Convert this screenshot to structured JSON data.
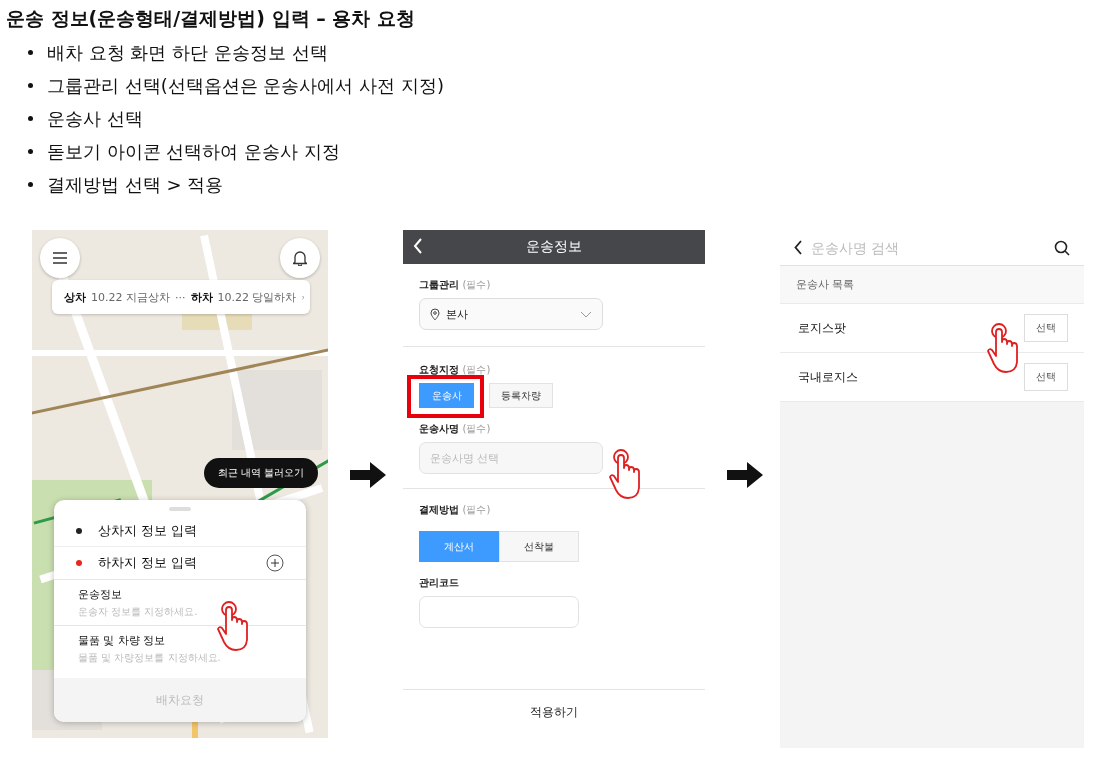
{
  "title": "운송 정보(운송형태/결제방법) 입력 – 용차 요청",
  "steps": [
    "배차 요청 화면 하단 운송정보 선택",
    "그룹관리 선택(선택옵션은 운송사에서 사전 지정)",
    "운송사 선택",
    "돋보기 아이콘 선택하여 운송사 지정",
    "결제방법 선택 > 적용"
  ],
  "screen_map": {
    "route_bar": {
      "pickup_label": "상차",
      "pickup_value": "10.22 지금상차",
      "separator": "···",
      "dropoff_label": "하차",
      "dropoff_value": "10.22 당일하차"
    },
    "recent_button": "최근 내역 불러오기",
    "locations": [
      {
        "label": "상차지 정보 입력",
        "color": "#222222"
      },
      {
        "label": "하차지 정보 입력",
        "color": "#e8281e"
      }
    ],
    "sections": [
      {
        "title": "운송정보",
        "hint": "운송자 정보를 지정하세요."
      },
      {
        "title": "물품 및 차량 정보",
        "hint": "물품 및 차량정보를 지정하세요."
      }
    ],
    "submit": {
      "label": "배차요청",
      "disabled": true
    }
  },
  "screen_form": {
    "header": "운송정보",
    "group": {
      "label": "그룹관리",
      "required": "(필수)",
      "value": "본사"
    },
    "request": {
      "label": "요청지정",
      "required": "(필수)",
      "options": [
        {
          "label": "운송사",
          "selected": true
        },
        {
          "label": "등록차량",
          "selected": false
        }
      ]
    },
    "carrier": {
      "label": "운송사명",
      "required": "(필수)",
      "placeholder": "운송사명 선택"
    },
    "payment": {
      "label": "결제방법",
      "required": "(필수)",
      "options": [
        {
          "label": "계산서",
          "selected": true
        },
        {
          "label": "선착불",
          "selected": false
        }
      ]
    },
    "code": {
      "label": "관리코드"
    },
    "apply": "적용하기"
  },
  "screen_search": {
    "placeholder": "운송사명 검색",
    "list_title": "운송사 목록",
    "carriers": [
      {
        "name": "로지스팟",
        "action": "선택"
      },
      {
        "name": "국내로지스",
        "action": "선택"
      }
    ]
  }
}
